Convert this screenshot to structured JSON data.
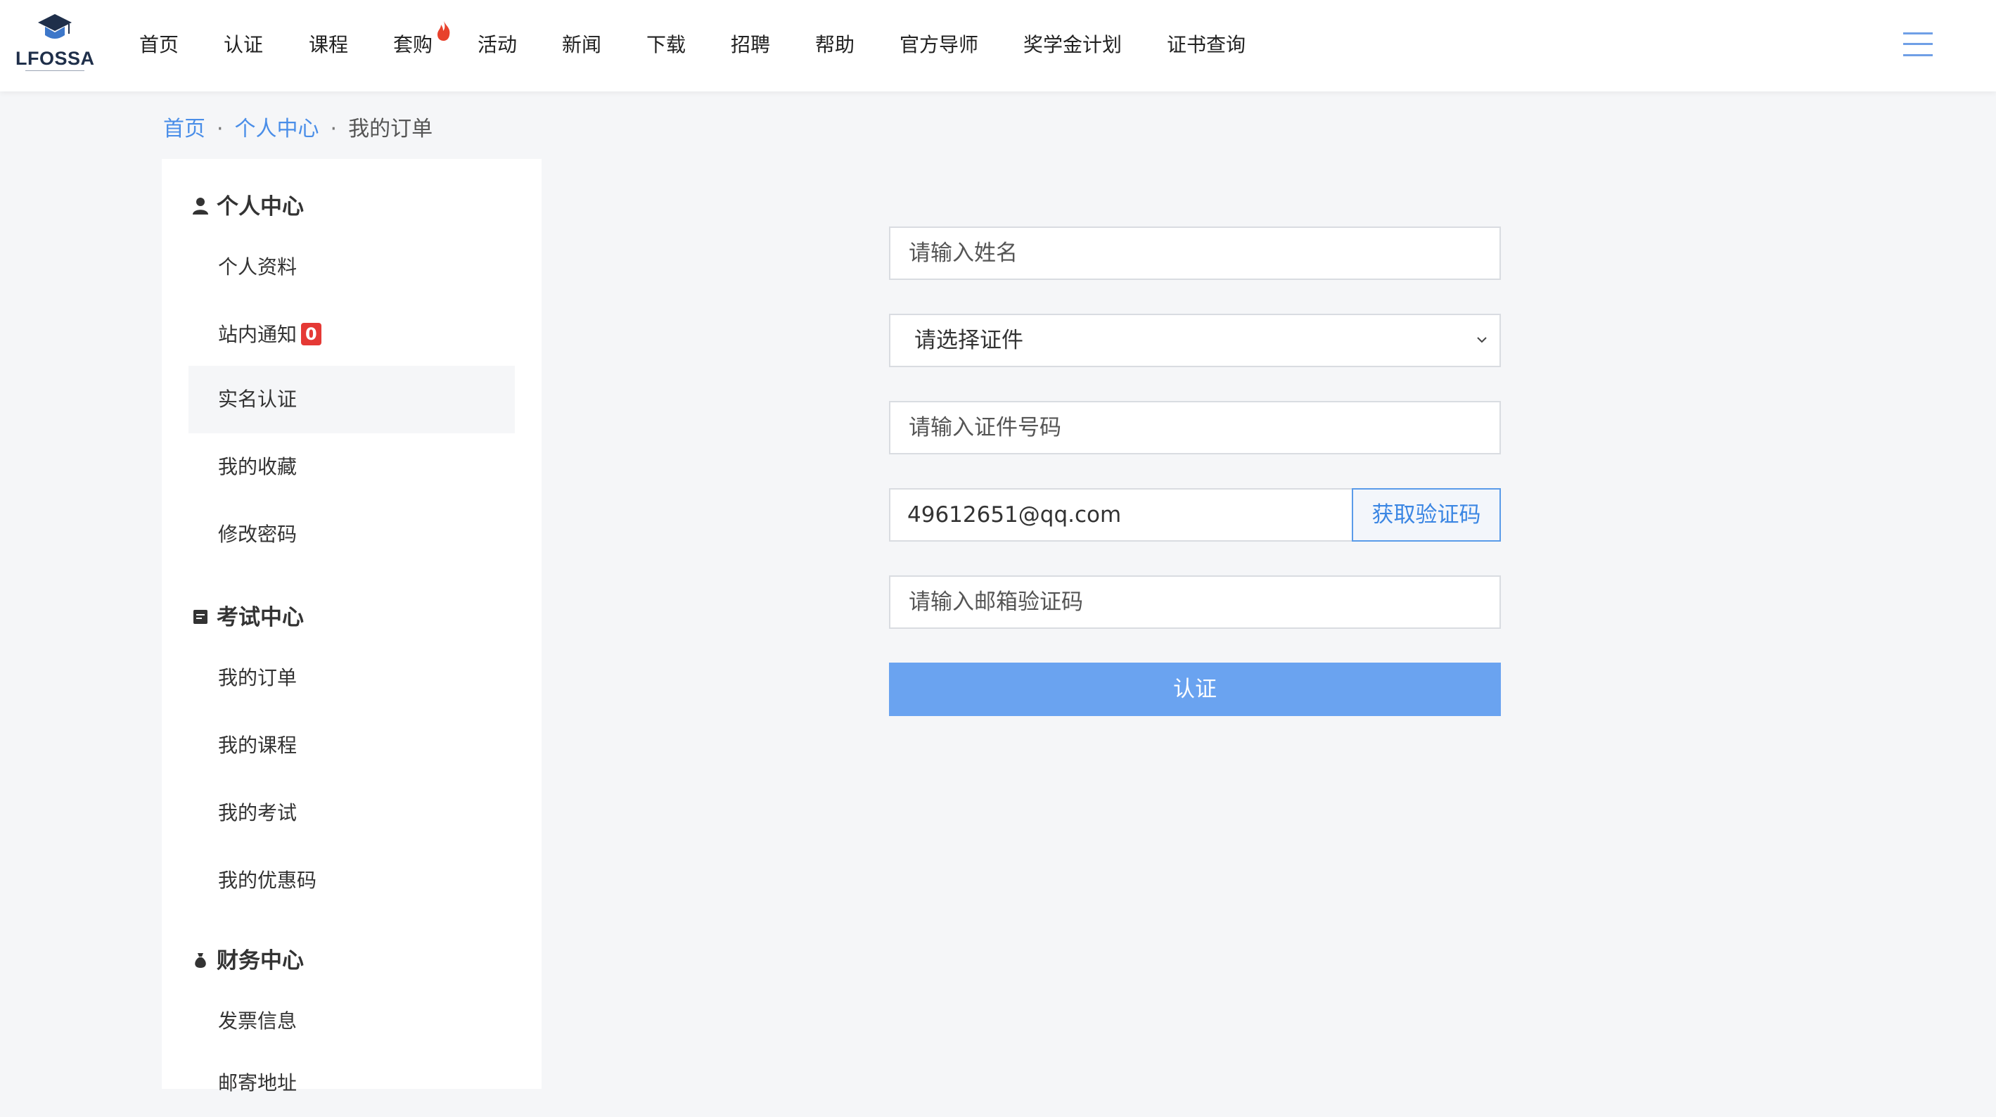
{
  "logo": {
    "text": "LFOSSA"
  },
  "nav": {
    "items": [
      "首页",
      "认证",
      "课程",
      "套购",
      "活动",
      "新闻",
      "下载",
      "招聘",
      "帮助",
      "官方导师",
      "奖学金计划",
      "证书查询"
    ]
  },
  "breadcrumb": {
    "home": "首页",
    "center": "个人中心",
    "current": "我的订单",
    "separator": "·"
  },
  "sidebar": {
    "personal": {
      "title": "个人中心",
      "items": [
        "个人资料",
        "站内通知",
        "实名认证",
        "我的收藏",
        "修改密码"
      ],
      "notification_count": "0"
    },
    "exam": {
      "title": "考试中心",
      "items": [
        "我的订单",
        "我的课程",
        "我的考试",
        "我的优惠码"
      ]
    },
    "finance": {
      "title": "财务中心",
      "items": [
        "发票信息",
        "邮寄地址"
      ]
    }
  },
  "form": {
    "name_placeholder": "请输入姓名",
    "id_type_selected": "请选择证件",
    "id_number_placeholder": "请输入证件号码",
    "email_value": "49612651@qq.com",
    "get_code_label": "获取验证码",
    "email_code_placeholder": "请输入邮箱验证码",
    "submit_label": "认证"
  },
  "colors": {
    "accent": "#4a8ee8",
    "submit": "#6aa3f0",
    "badge": "#e53935",
    "hot": "#e8412c"
  }
}
